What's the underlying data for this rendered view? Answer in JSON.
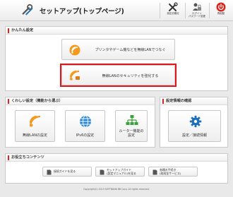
{
  "header": {
    "title": "セットアップ(トップページ)",
    "buttons": [
      {
        "label": "設定初期化",
        "icon": "wrench-screwdriver-icon"
      },
      {
        "label": "ログイン\nパスワード変更",
        "icon": "lock-person-icon"
      },
      {
        "label": "再起動",
        "icon": "power-icon"
      }
    ]
  },
  "easy": {
    "heading": "かんたん設定",
    "items": [
      {
        "label": "プリンタやゲーム機などを無線LANでつなぐ",
        "icon": "wireless-connect-icon"
      },
      {
        "label": "無線LANのセキュリティを強化する",
        "icon": "wireless-security-icon",
        "highlighted": true
      }
    ]
  },
  "detail": {
    "heading": "くわしい設定（機能から選ぶ）",
    "items": [
      {
        "label": "無線LANの設定",
        "icon": "wireless-icon"
      },
      {
        "label": "IPv6の設定",
        "icon": "globe-icon"
      },
      {
        "label": "ルーター機能の\n設定",
        "icon": "network-tree-icon"
      }
    ]
  },
  "status": {
    "heading": "設定情報の確認",
    "item": {
      "label": "設定／接続情報",
      "icon": "gear-icon"
    }
  },
  "contents": {
    "heading": "お役立ちコンテンツ",
    "items": [
      {
        "label": "接続ガイドを見る",
        "icon": "document-icon"
      },
      {
        "label": "セットアップガイド\n(設定マニュアル)を見る",
        "icon": "document-icon"
      },
      {
        "label": "各種お手続き\n(助成金サービス)",
        "icon": "document-icon"
      }
    ]
  },
  "footer": {
    "copyright": "Copyright(C) 2013 SOFTBANK BB Corp. All rights reserved."
  },
  "colors": {
    "accent": "#d9261c",
    "highlight": "#e0141b",
    "wireless": "#f39a1e",
    "globe": "#2a86d6",
    "tree": "#3aa33a",
    "gear": "#1e6fb8"
  }
}
